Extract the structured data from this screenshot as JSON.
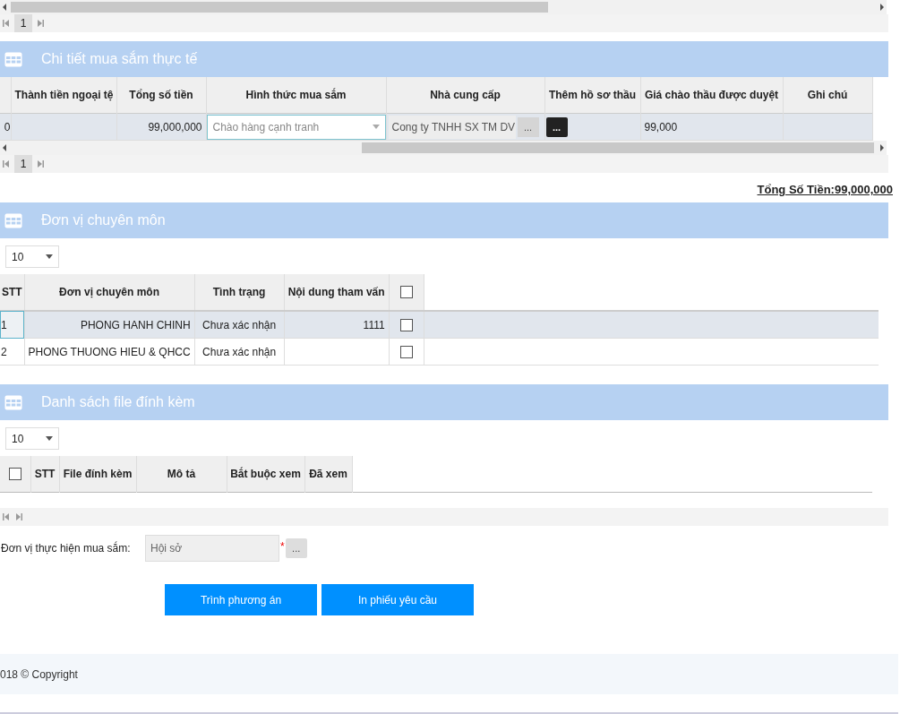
{
  "top_pager": {
    "page": "1"
  },
  "procurement": {
    "title": "Chi tiết mua sắm thực tế",
    "columns": [
      "Thành tiền ngoại tệ",
      "Tổng số tiền",
      "Hình thức mua sắm",
      "Nhà cung cấp",
      "Thêm hồ sơ thầu",
      "Giá chào thầu được duyệt",
      "Ghi chú"
    ],
    "row": {
      "column_1": "0",
      "total": "99,000,000",
      "method_placeholder": "Chào hàng cạnh tranh",
      "supplier": "Cong ty TNHH SX TM DV",
      "supplier_button": "...",
      "bid_button": "...",
      "approved_price": "99,000"
    },
    "pager": {
      "page": "1"
    }
  },
  "grand_total": "Tổng Số Tiền:99,000,000",
  "units": {
    "title": "Đơn vị chuyên môn",
    "page_size": "10",
    "select_all_checked": false,
    "columns": [
      "STT",
      "Đơn vị chuyên môn",
      "Tình trạng",
      "Nội dung tham vấn"
    ],
    "rows": [
      {
        "stt": "1",
        "unit": "PHONG HANH CHINH",
        "status": "Chưa xác nhận",
        "content": "1111",
        "checked": false,
        "selected": true
      },
      {
        "stt": "2",
        "unit": "PHONG THUONG HIEU & QHCC",
        "status": "Chưa xác nhận",
        "checked": false,
        "selected": false
      }
    ]
  },
  "files": {
    "title": "Danh sách file đính kèm",
    "page_size": "10",
    "select_all_checked": false,
    "columns": [
      "STT",
      "File đính kèm",
      "Mô tả",
      "Bắt buộc xem",
      "Đã xem"
    ]
  },
  "form": {
    "label": "Đơn vị thực hiện mua sắm:",
    "value": "Hội sở",
    "required_mark": "*",
    "browse_button": "..."
  },
  "buttons": [
    "Trình phương án",
    "In phiếu yêu cầu"
  ],
  "footer": "018 © Copyright"
}
